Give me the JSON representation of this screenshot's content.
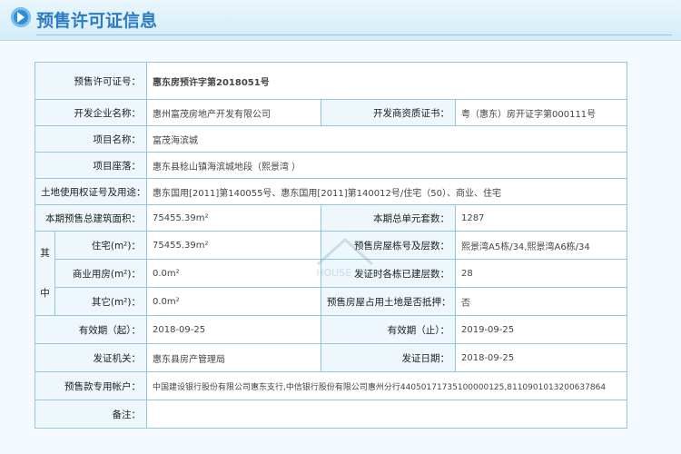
{
  "header": {
    "title": "预售许可证信息"
  },
  "license": {
    "number_label": "预售许可证号：",
    "number": "惠东房预许字第2018051号",
    "developer_label": "开发企业名称：",
    "developer": "惠州富茂房地产开发有限公司",
    "qualification_label": "开发商资质证书：",
    "qualification": "粤（惠东）房开证字第000111号",
    "project_label": "项目名称：",
    "project": "富茂海滨城",
    "location_label": "项目座落：",
    "location": "惠东县稔山镇海滨城地段（熙景湾 ）",
    "land_label": "土地使用权证号及用途：",
    "land": "惠东国用[2011]第140055号、惠东国用[2011]第140012号/住宅（50）、商业、住宅",
    "total_area_label": "本期预售总建筑面积：",
    "total_area": "75455.39m²",
    "total_units_label": "本期总单元套数：",
    "total_units": "1287",
    "of_which_label_1": "其",
    "of_which_label_2": "中",
    "residential_label": "住宅(m²)：",
    "residential": "75455.39m²",
    "building_no_label": "预售房屋栋号及层数：",
    "building_no": "熙景湾A5栋/34,熙景湾A6栋/34",
    "commercial_label": "商业用房(m²)：",
    "commercial": "0.0m²",
    "floors_built_label": "发证时各栋已建层数：",
    "floors_built": "28",
    "other_label": "其它(m²)：",
    "other": "0.0m²",
    "mortgage_label": "预售房屋占用土地是否抵押：",
    "mortgage": "否",
    "valid_from_label": "有效期（起）：",
    "valid_from": "2018-09-25",
    "valid_to_label": "有效期（止）：",
    "valid_to": "2019-09-25",
    "issuer_label": "发证机关：",
    "issuer": "惠东县房产管理局",
    "issue_date_label": "发证日期：",
    "issue_date": "2018-09-25",
    "account_label": "预售款专用帐户：",
    "account": "中国建设银行股份有限公司惠东支行,中信银行股份有限公司惠州分行44050171735100000125,8110901013200637864",
    "remarks_label": "备注：",
    "remarks": ""
  },
  "watermark": {
    "text": "HOUSE 365"
  }
}
